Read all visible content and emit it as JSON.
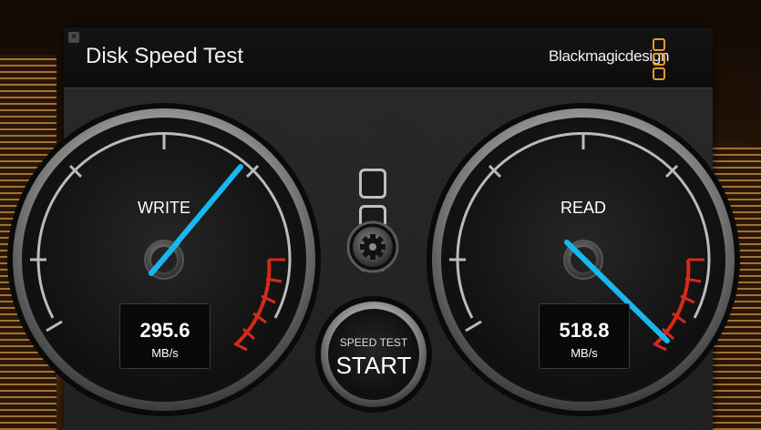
{
  "window": {
    "title": "Disk Speed Test",
    "close_glyph": "×",
    "brand": "Blackmagicdesign"
  },
  "gauges": {
    "write": {
      "label": "WRITE",
      "value": "295.6",
      "unit": "MB/s",
      "accent": "#17b8f0"
    },
    "read": {
      "label": "READ",
      "value": "518.8",
      "unit": "MB/s",
      "accent": "#17b8f0"
    }
  },
  "controls": {
    "settings_icon": "gear-icon",
    "start_top": "SPEED TEST",
    "start_main": "START"
  },
  "colors": {
    "brand_orange": "#e39b2c",
    "redline": "#d42a1a"
  }
}
